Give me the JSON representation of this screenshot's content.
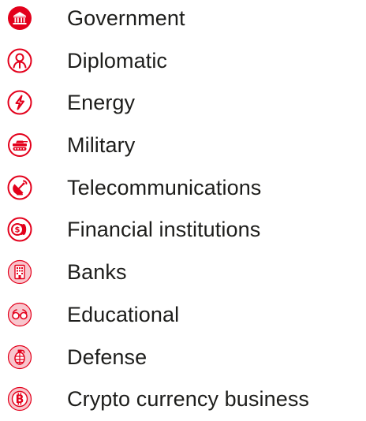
{
  "sectors": [
    {
      "label": "Government",
      "icon": "government-building-icon"
    },
    {
      "label": "Diplomatic",
      "icon": "person-icon"
    },
    {
      "label": "Energy",
      "icon": "lightning-bolt-icon"
    },
    {
      "label": "Military",
      "icon": "tank-icon"
    },
    {
      "label": "Telecommunications",
      "icon": "satellite-dish-icon"
    },
    {
      "label": "Financial institutions",
      "icon": "coins-icon"
    },
    {
      "label": "Banks",
      "icon": "bank-building-icon"
    },
    {
      "label": "Educational",
      "icon": "glasses-icon"
    },
    {
      "label": "Defense",
      "icon": "grenade-icon"
    },
    {
      "label": "Crypto currency business",
      "icon": "bitcoin-icon"
    }
  ],
  "colors": {
    "accent": "#e3001b",
    "accent_light": "#f8c6cd",
    "text": "#1d1d1b"
  }
}
